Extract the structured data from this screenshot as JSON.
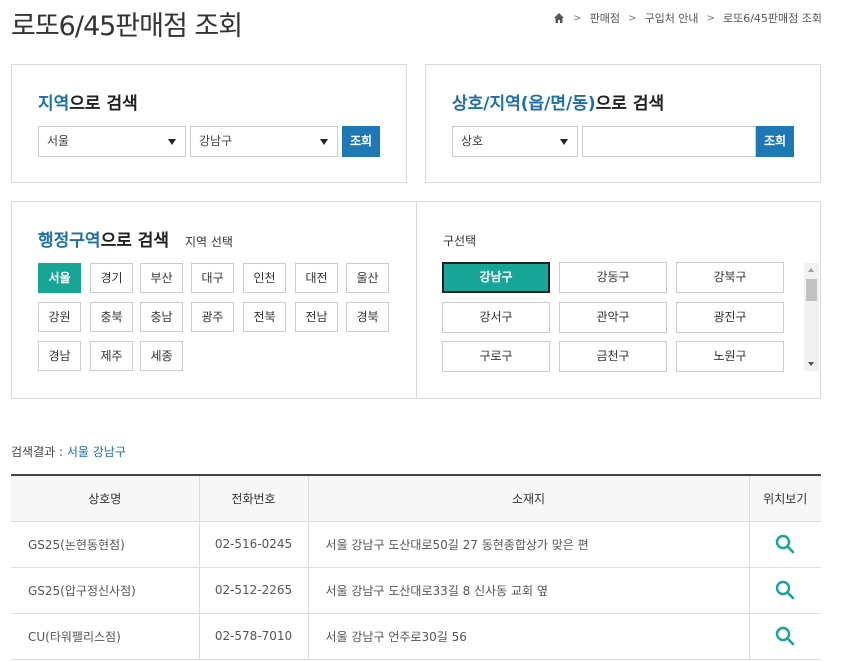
{
  "page": {
    "title": "로또6/45판매점 조회",
    "breadcrumb": [
      "판매점",
      "구입처 안내",
      "로또6/45판매점 조회"
    ]
  },
  "region_search": {
    "title_accent": "지역",
    "title_rest": "으로 검색",
    "city_value": "서울",
    "district_value": "강남구",
    "button_label": "조회"
  },
  "name_search": {
    "title_accent": "상호/지역(읍/면/동)",
    "title_rest": "으로 검색",
    "type_value": "상호",
    "input_value": "",
    "button_label": "조회"
  },
  "admin_search": {
    "title_accent": "행정구역",
    "title_rest": "으로 검색",
    "subtitle": "지역 선택",
    "regions": [
      "서울",
      "경기",
      "부산",
      "대구",
      "인천",
      "대전",
      "울산",
      "강원",
      "충북",
      "충남",
      "광주",
      "전북",
      "전남",
      "경북",
      "경남",
      "제주",
      "세종"
    ],
    "active_region": "서울",
    "district_label": "구선택",
    "districts": [
      "강남구",
      "강동구",
      "강북구",
      "강서구",
      "관악구",
      "광진구",
      "구로구",
      "금천구",
      "노원구"
    ],
    "active_district": "강남구"
  },
  "results": {
    "label": "검색결과 : ",
    "value": "서울 강남구",
    "headers": [
      "상호명",
      "전화번호",
      "소재지",
      "위치보기"
    ],
    "rows": [
      {
        "name": "GS25(논현동현점)",
        "phone": "02-516-0245",
        "address": "서울 강남구 도산대로50길 27 동현종합상가 맞은 편"
      },
      {
        "name": "GS25(압구정신사점)",
        "phone": "02-512-2265",
        "address": "서울 강남구 도산대로33길 8 신사동 교회 옆"
      },
      {
        "name": "CU(타워팰리스점)",
        "phone": "02-578-7010",
        "address": "서울 강남구 언주로30길 56"
      }
    ]
  },
  "colors": {
    "accent_blue": "#1e6fa8",
    "button_blue": "#1e78b6",
    "teal": "#17a597"
  },
  "icons": {
    "home": "home-icon",
    "search": "search-icon"
  }
}
